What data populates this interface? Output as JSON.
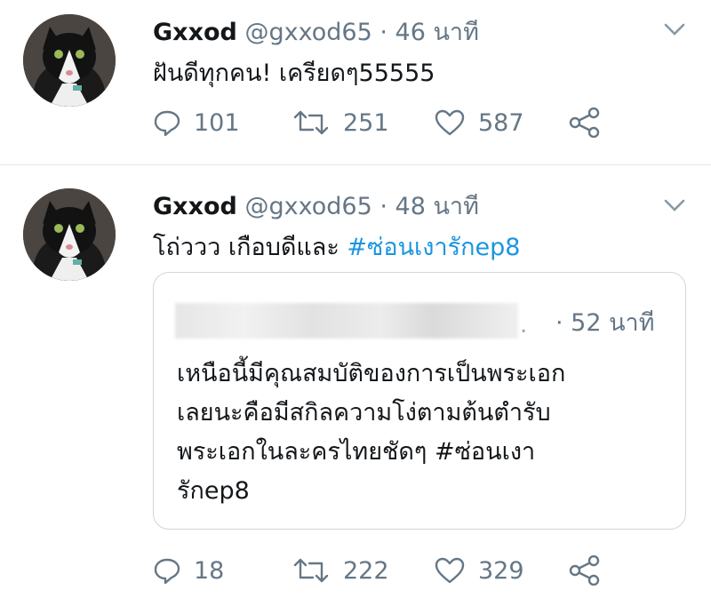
{
  "tweets": [
    {
      "name": "Gxxod",
      "handle": "@gxxod65",
      "separator": "·",
      "time": "46 นาที",
      "text": "ฝันดีทุกคน! เครียดๆ55555",
      "replies": "101",
      "retweets": "251",
      "likes": "587"
    },
    {
      "name": "Gxxod",
      "handle": "@gxxod65",
      "separator": "·",
      "time": "48 นาที",
      "text_prefix": "โถ่ววว เกือบดีและ ",
      "hashtag": "#ซ่อนเงารักep8",
      "quote": {
        "name_tail": ".",
        "time": "· 52 นาที",
        "lines": [
          "เหนือนี้มีคุณสมบัติของการเป็นพระเอก",
          "เลยนะคือมีสกิลความโง่ตามต้นตำรับ",
          "พระเอกในละครไทยชัดๆ #ซ่อนเงา",
          "รักep8"
        ]
      },
      "replies": "18",
      "retweets": "222",
      "likes": "329"
    }
  ],
  "colors": {
    "text": "#14171a",
    "secondary": "#657786",
    "link": "#1b95e0",
    "border": "#ccd6dd"
  },
  "icons": [
    "reply-icon",
    "retweet-icon",
    "like-icon",
    "share-icon",
    "chevron-down-icon"
  ]
}
